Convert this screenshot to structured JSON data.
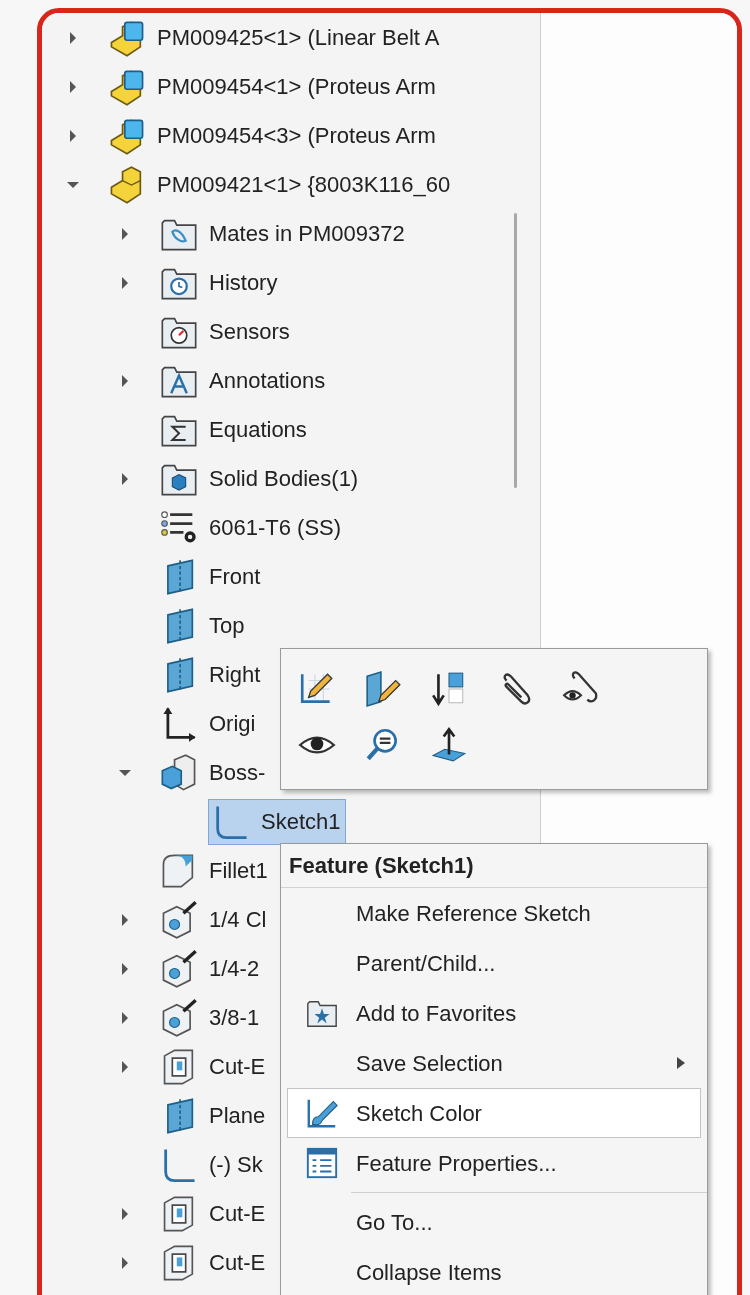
{
  "tree": {
    "items": [
      {
        "label": "PM009425<1> (Linear Belt A",
        "kind": "assembly",
        "expanded": false,
        "selected": false
      },
      {
        "label": "PM009454<1> (Proteus Arm",
        "kind": "assembly",
        "expanded": false,
        "selected": false
      },
      {
        "label": "PM009454<3> (Proteus Arm",
        "kind": "assembly",
        "expanded": false,
        "selected": false
      },
      {
        "label": "PM009421<1> {8003K116_60",
        "kind": "part",
        "expanded": true,
        "selected": false,
        "children": [
          {
            "label": "Mates in PM009372",
            "kind": "folder_mates",
            "expanded": false,
            "selected": false
          },
          {
            "label": "History",
            "kind": "folder_history",
            "expanded": false,
            "selected": false
          },
          {
            "label": "Sensors",
            "kind": "folder_sensors",
            "selected": false
          },
          {
            "label": "Annotations",
            "kind": "folder_annotations",
            "expanded": false,
            "selected": false
          },
          {
            "label": "Equations",
            "kind": "folder_equations",
            "selected": false
          },
          {
            "label": "Solid Bodies(1)",
            "kind": "folder_bodies",
            "expanded": false,
            "selected": false
          },
          {
            "label": "6061-T6 (SS)",
            "kind": "material",
            "selected": false
          },
          {
            "label": "Front",
            "kind": "plane",
            "selected": false
          },
          {
            "label": "Top",
            "kind": "plane",
            "selected": false
          },
          {
            "label": "Right",
            "kind": "plane",
            "selected": false
          },
          {
            "label": "Origi",
            "kind": "origin",
            "selected": false
          },
          {
            "label": "Boss-",
            "kind": "extrude",
            "expanded": true,
            "selected": false,
            "children": [
              {
                "label": "Sketch1",
                "kind": "sketch",
                "selected": true
              }
            ]
          },
          {
            "label": "Fillet1",
            "kind": "fillet",
            "selected": false
          },
          {
            "label": "1/4 Cl",
            "kind": "hole",
            "expanded": false,
            "selected": false
          },
          {
            "label": "1/4-2",
            "kind": "hole",
            "expanded": false,
            "selected": false
          },
          {
            "label": "3/8-1",
            "kind": "hole",
            "expanded": false,
            "selected": false
          },
          {
            "label": "Cut-E",
            "kind": "cut",
            "expanded": false,
            "selected": false
          },
          {
            "label": "Plane",
            "kind": "plane",
            "selected": false
          },
          {
            "label": "(-) Sk",
            "kind": "sketch",
            "selected": false
          },
          {
            "label": "Cut-E",
            "kind": "cut",
            "expanded": false,
            "selected": false
          },
          {
            "label": "Cut-E",
            "kind": "cut",
            "expanded": false,
            "selected": false
          }
        ]
      }
    ]
  },
  "toolbar": {
    "rows": [
      [
        {
          "kind": "edit_sketch"
        },
        {
          "kind": "edit_feature"
        },
        {
          "kind": "rollback"
        },
        {
          "kind": "paperclip"
        },
        {
          "kind": "paperclip_eye"
        }
      ],
      [
        {
          "kind": "eye"
        },
        {
          "kind": "zoom"
        },
        {
          "kind": "normal_to"
        }
      ]
    ]
  },
  "context_menu": {
    "title": "Feature (Sketch1)",
    "items": [
      {
        "kind": "plain",
        "label": "Make Reference Sketch",
        "highlighted": false
      },
      {
        "kind": "plain",
        "label": "Parent/Child...",
        "highlighted": false
      },
      {
        "kind": "favorites",
        "label": "Add to Favorites",
        "highlighted": false
      },
      {
        "kind": "plain",
        "label": "Save Selection",
        "submenu": true,
        "highlighted": false
      },
      {
        "kind": "brush",
        "label": "Sketch Color",
        "highlighted": true
      },
      {
        "kind": "properties",
        "label": "Feature Properties...",
        "highlighted": false
      },
      {
        "kind": "separator"
      },
      {
        "kind": "plain",
        "label": "Go To...",
        "highlighted": false
      },
      {
        "kind": "plain",
        "label": "Collapse Items",
        "highlighted": false
      }
    ]
  }
}
